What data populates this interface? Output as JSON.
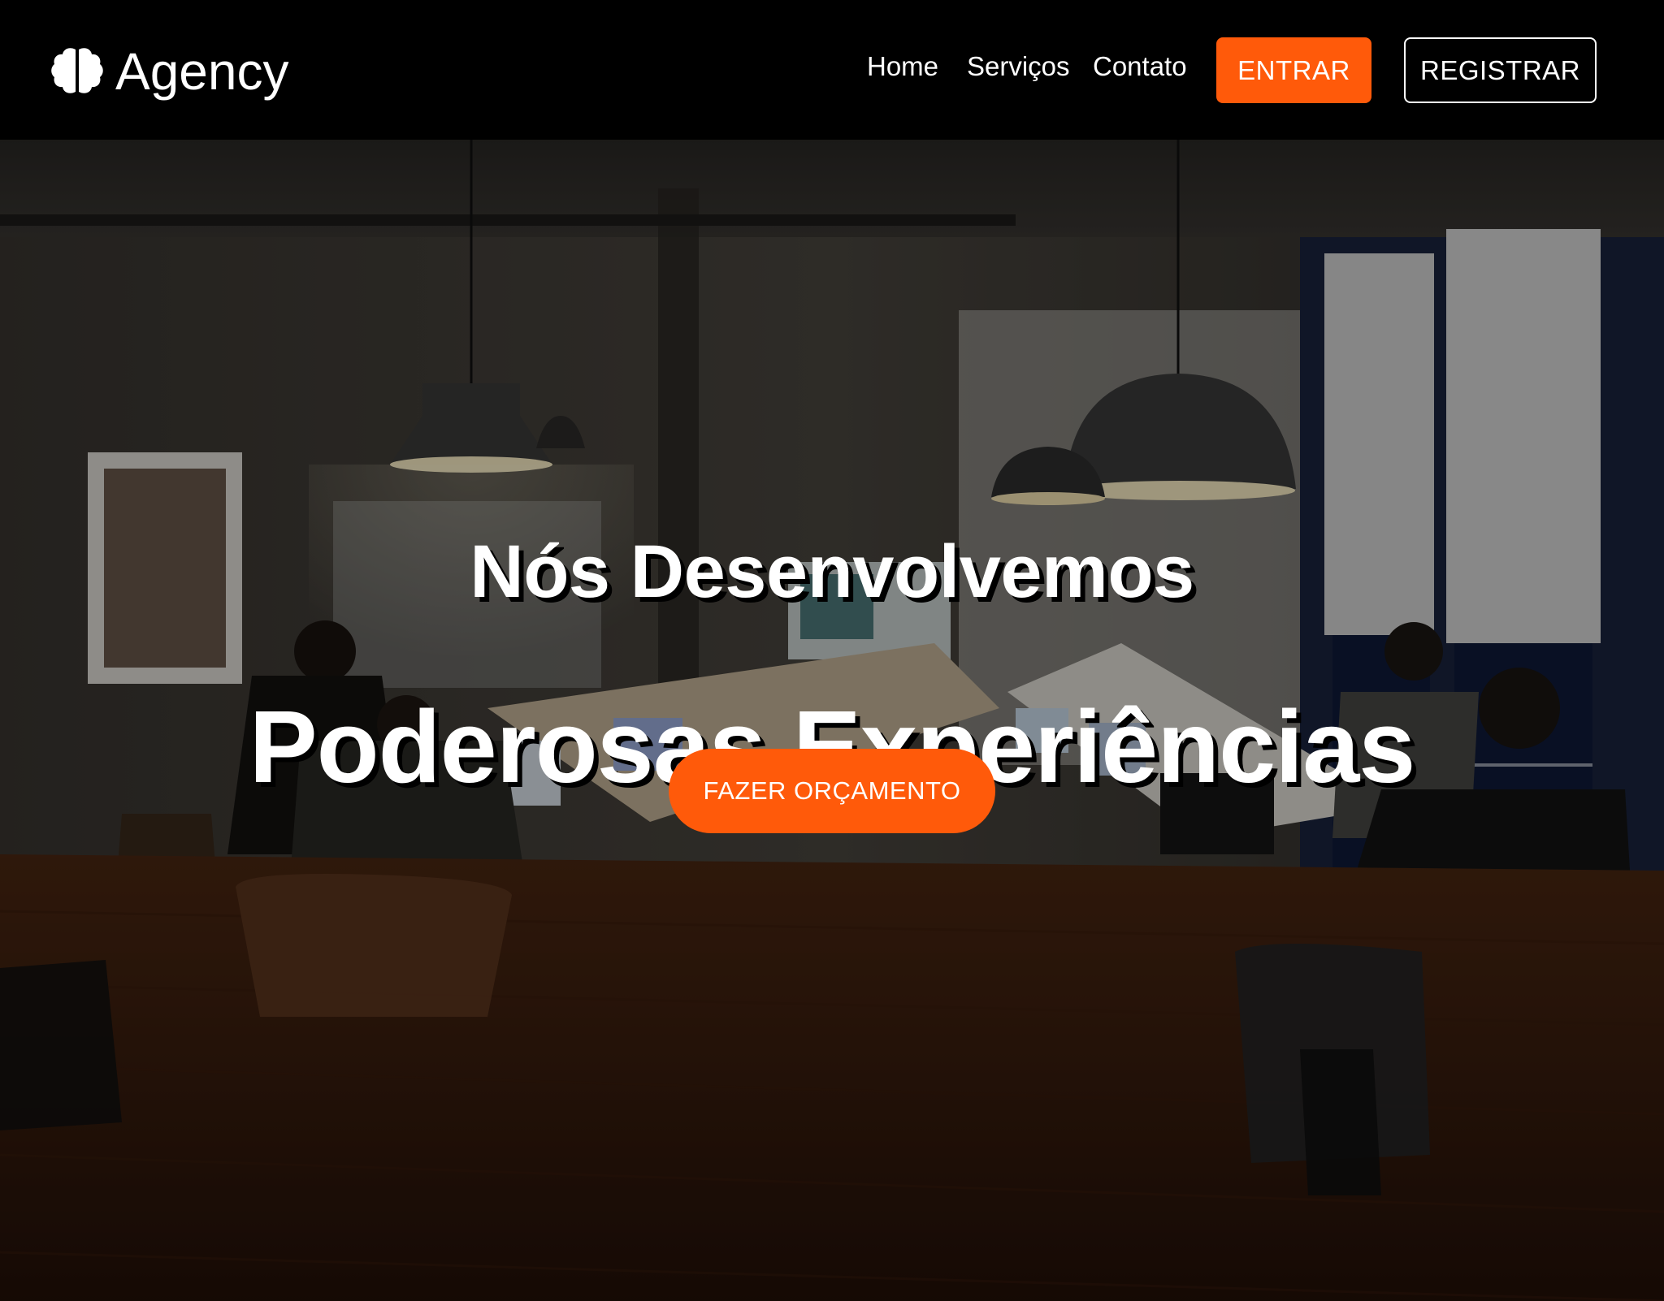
{
  "brand": {
    "name": "Agency",
    "icon": "brain-icon"
  },
  "nav": {
    "links": [
      {
        "label": "Home"
      },
      {
        "label": "Serviços"
      },
      {
        "label": "Contato"
      }
    ],
    "login_label": "ENTRAR",
    "register_label": "REGISTRAR"
  },
  "hero": {
    "title_line_1": "Nós Desenvolvemos",
    "title_line_2": "Poderosas Experiências",
    "cta_label": "FAZER ORÇAMENTO",
    "background": "office-team-photo"
  },
  "colors": {
    "accent": "#ff5a0a",
    "navbar_bg": "#000000",
    "text": "#ffffff"
  }
}
